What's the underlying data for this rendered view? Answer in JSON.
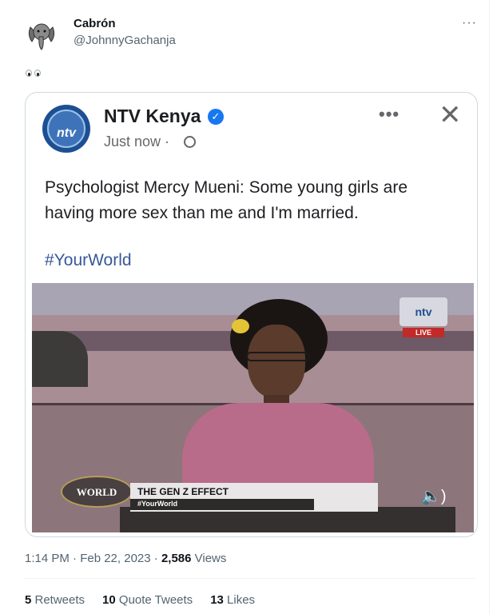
{
  "tweet": {
    "author_name": "Cabrón",
    "author_handle": "@JohnnyGachanja",
    "more_label": "···",
    "text_emoji": "eyes-emoji",
    "time": "1:14 PM · Feb 22, 2023 · ",
    "views_count": "2,586",
    "views_label": " Views"
  },
  "embedded_post": {
    "page_name": "NTV Kenya",
    "logo_text": "ntv",
    "timestamp": "Just now ·",
    "more_label": "•••",
    "close_label": "✕",
    "text": "Psychologist Mercy Mueni: Some young girls are having more sex than me and I'm married.",
    "hashtag": "#YourWorld",
    "video": {
      "live_logo": "ntv",
      "live_label": "LIVE",
      "show_logo": "WORLD",
      "banner_title": "THE GEN Z EFFECT",
      "banner_sub": "#YourWorld",
      "sound_icon": "🔈)"
    }
  },
  "engagement": {
    "retweets_count": "5",
    "retweets_label": " Retweets",
    "quotes_count": "10",
    "quotes_label": " Quote Tweets",
    "likes_count": "13",
    "likes_label": " Likes"
  },
  "colors": {
    "facebook_blue": "#1877f2",
    "ntv_blue": "#1d4f93",
    "link": "#385898"
  }
}
